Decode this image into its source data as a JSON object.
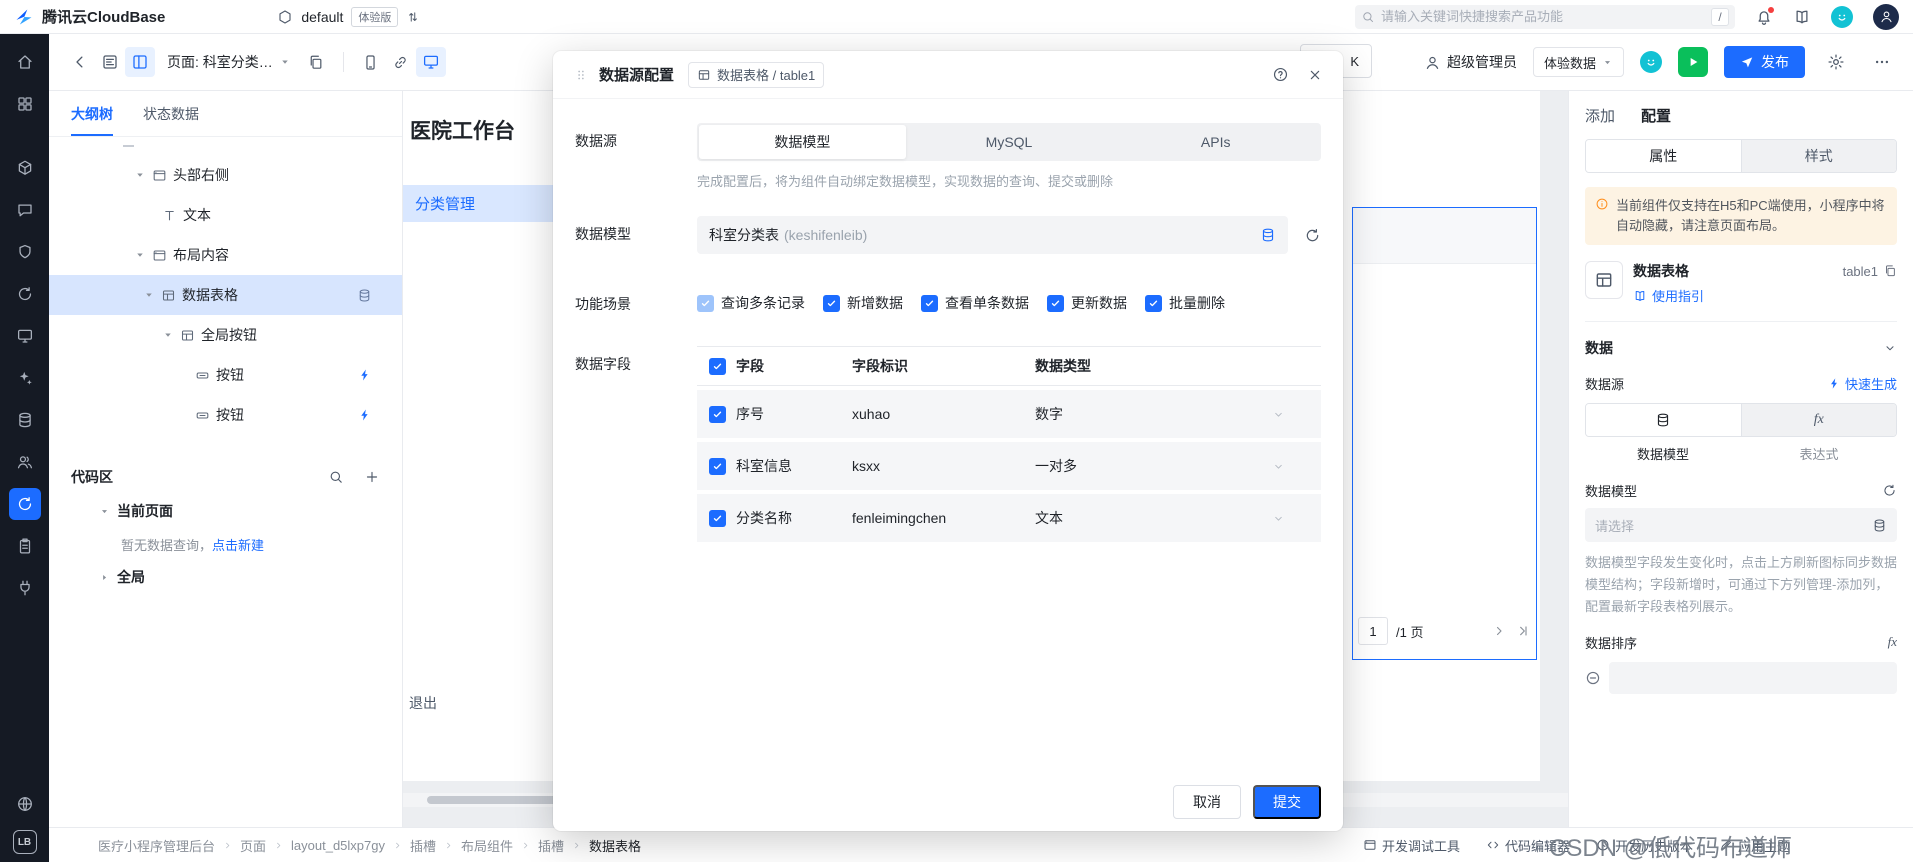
{
  "colors": {
    "accent": "#1c6cff",
    "success": "#0abf5b",
    "warning": "#ff8d1a",
    "selection": "#d7e5fe"
  },
  "icons": {
    "help": "?",
    "fx": "fx"
  },
  "topbar": {
    "brand": "腾讯云CloudBase",
    "env_name": "default",
    "env_badge": "体验版",
    "search_placeholder": "请输入关键词快捷搜索产品功能",
    "search_shortcut": "/"
  },
  "subtoolbar": {
    "page_selector": "页面: 科室分类…",
    "partial_button": "K",
    "admin_label": "超级管理员",
    "preview_data_label": "体验数据",
    "publish_label": "发布"
  },
  "rail": {
    "logo_text": "LB"
  },
  "left_panel": {
    "tabs": {
      "outline": "大纲树",
      "state": "状态数据"
    },
    "tree": [
      {
        "label": "头部右侧"
      },
      {
        "label": "文本"
      },
      {
        "label": "布局内容"
      },
      {
        "label": "数据表格"
      },
      {
        "label": "全局按钮"
      },
      {
        "label": "按钮"
      },
      {
        "label": "按钮"
      }
    ],
    "code_area": {
      "title": "代码区",
      "current_page": "当前页面",
      "empty_text": "暂无数据查询，",
      "empty_link": "点击新建",
      "global": "全局"
    }
  },
  "canvas": {
    "page_title": "医院工作台",
    "active_menu": "分类管理",
    "logout": "退出",
    "pagination": {
      "current": "1",
      "total": "/1 页"
    }
  },
  "modal": {
    "title": "数据源配置",
    "chip": "数据表格 / table1",
    "source_label": "数据源",
    "source_tabs": [
      "数据模型",
      "MySQL",
      "APIs"
    ],
    "source_hint": "完成配置后，将为组件自动绑定数据模型，实现数据的查询、提交或删除",
    "model_label": "数据模型",
    "model_value": "科室分类表",
    "model_value_suffix": "(keshifenleib)",
    "scene_label": "功能场景",
    "scenes": [
      {
        "label": "查询多条记录"
      },
      {
        "label": "新增数据"
      },
      {
        "label": "查看单条数据"
      },
      {
        "label": "更新数据"
      },
      {
        "label": "批量删除"
      }
    ],
    "fields_label": "数据字段",
    "table": {
      "headers": [
        "字段",
        "字段标识",
        "数据类型"
      ],
      "rows": [
        {
          "field": "序号",
          "key": "xuhao",
          "type": "数字"
        },
        {
          "field": "科室信息",
          "key": "ksxx",
          "type": "一对多"
        },
        {
          "field": "分类名称",
          "key": "fenleimingchen",
          "type": "文本"
        }
      ]
    },
    "cancel": "取消",
    "submit": "提交"
  },
  "right_panel": {
    "tabs": {
      "add": "添加",
      "config": "配置"
    },
    "sub_tabs": {
      "props": "属性",
      "style": "样式"
    },
    "notice": "当前组件仅支持在H5和PC端使用，小程序中将自动隐藏，请注意页面布局。",
    "component": {
      "name": "数据表格",
      "id": "table1",
      "guide": "使用指引"
    },
    "data": {
      "section": "数据",
      "source_label": "数据源",
      "quick_generate": "快速生成",
      "mode_model": "数据模型",
      "mode_expression": "表达式",
      "model_label": "数据模型",
      "select_placeholder": "请选择",
      "hint": "数据模型字段发生变化时，点击上方刷新图标同步数据模型结构；字段新增时，可通过下方列管理-添加列，配置最新字段表格列展示。",
      "sort_label": "数据排序"
    }
  },
  "bottom_bar": {
    "breadcrumbs": [
      "医疗小程序管理后台",
      "页面",
      "layout_d5lxp7gy",
      "插槽",
      "布局组件",
      "插槽",
      "数据表格"
    ],
    "tools": [
      "开发调试工具",
      "代码编辑器",
      "开发历史版本",
      "应用主题"
    ],
    "watermark": "CSDN @低代码布道师"
  }
}
